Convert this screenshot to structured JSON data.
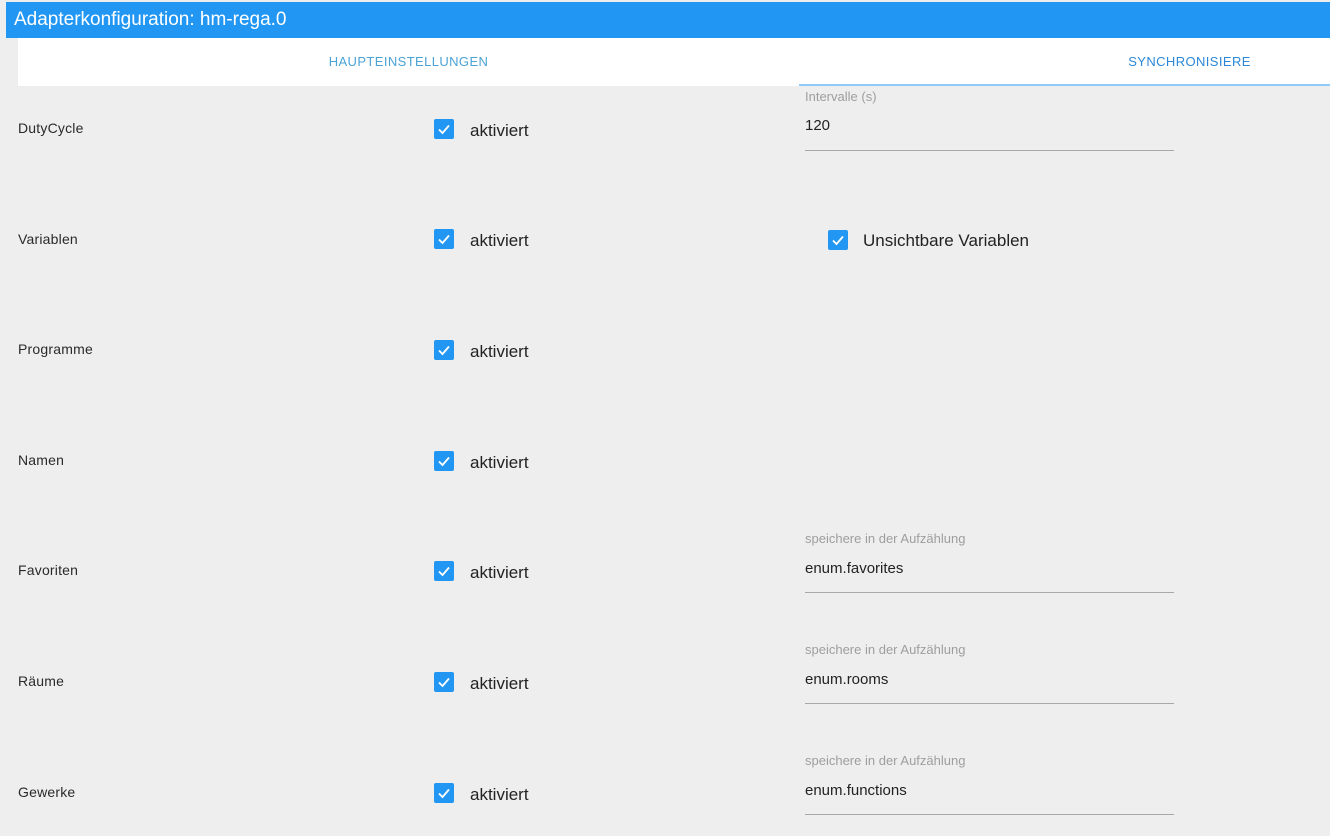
{
  "window": {
    "title": "Adapterkonfiguration: hm-rega.0"
  },
  "tabs": [
    {
      "label": "HAUPTEINSTELLUNGEN"
    },
    {
      "label": "SYNCHRONISIERE"
    }
  ],
  "rows": [
    {
      "label": "DutyCycle",
      "checkbox": "aktiviert",
      "checked": true,
      "field": {
        "hint": "Intervalle (s)",
        "value": "120"
      }
    },
    {
      "label": "Variablen",
      "checkbox": "aktiviert",
      "checked": true,
      "extra_checkbox": {
        "label": "Unsichtbare Variablen",
        "checked": true
      }
    },
    {
      "label": "Programme",
      "checkbox": "aktiviert",
      "checked": true
    },
    {
      "label": "Namen",
      "checkbox": "aktiviert",
      "checked": true
    },
    {
      "label": "Favoriten",
      "checkbox": "aktiviert",
      "checked": true,
      "field": {
        "hint": "speichere in der Aufzählung",
        "value": "enum.favorites"
      }
    },
    {
      "label": "Räume",
      "checkbox": "aktiviert",
      "checked": true,
      "field": {
        "hint": "speichere in der Aufzählung",
        "value": "enum.rooms"
      }
    },
    {
      "label": "Gewerke",
      "checkbox": "aktiviert",
      "checked": true,
      "field": {
        "hint": "speichere in der Aufzählung",
        "value": "enum.functions"
      }
    }
  ],
  "colors": {
    "accent": "#2196f3",
    "background": "#eeeeee",
    "tab_text": "#4ba3d6"
  },
  "icons": {
    "checkbox_checked": "check-icon"
  }
}
